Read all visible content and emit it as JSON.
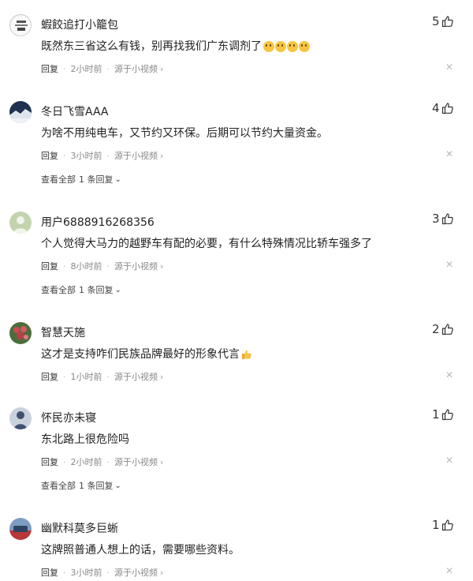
{
  "comments": [
    {
      "username": "蝦餃追打小籠包",
      "text": "既然东三省这么有钱，别再找我们广东调剂了",
      "emoji_count": 4,
      "likes": "5",
      "reply": "回复",
      "time": "2小时前",
      "source": "源于小视频",
      "avatar_colors": [
        "#f4f4f4",
        "#6a6a6a"
      ]
    },
    {
      "username": "冬日飞雪AAA",
      "text": "为啥不用纯电车，又节约又环保。后期可以节约大量资金。",
      "likes": "4",
      "reply": "回复",
      "time": "3小时前",
      "source": "源于小视频",
      "view_all": "查看全部",
      "reply_count": "1 条回复",
      "avatar_colors": [
        "#253653",
        "#d6dde8"
      ]
    },
    {
      "username": "用户6888916268356",
      "text": "个人觉得大马力的越野车有配的必要，有什么特殊情况比轿车强多了",
      "likes": "3",
      "reply": "回复",
      "time": "8小时前",
      "source": "源于小视频",
      "view_all": "查看全部",
      "reply_count": "1 条回复",
      "avatar_colors": [
        "#b9c9a4",
        "#e8eed9"
      ]
    },
    {
      "username": "智慧天施",
      "text": "这才是支持咋们民族品牌最好的形象代言",
      "thumb_emoji": true,
      "likes": "2",
      "reply": "回复",
      "time": "1小时前",
      "source": "源于小视频",
      "avatar_colors": [
        "#a6424a",
        "#3e6a33"
      ]
    },
    {
      "username": "怀民亦未寝",
      "text": "东北路上很危险吗",
      "likes": "1",
      "reply": "回复",
      "time": "2小时前",
      "source": "源于小视频",
      "view_all": "查看全部",
      "reply_count": "1 条回复",
      "avatar_colors": [
        "#4a5c7a",
        "#c7cfda"
      ]
    },
    {
      "username": "幽默科莫多巨蜥",
      "text": "这牌照普通人想上的话，需要哪些资料。",
      "likes": "1",
      "reply": "回复",
      "time": "3小时前",
      "source": "源于小视频",
      "avatar_colors": [
        "#5e7fa6",
        "#cc3d3d"
      ]
    }
  ]
}
